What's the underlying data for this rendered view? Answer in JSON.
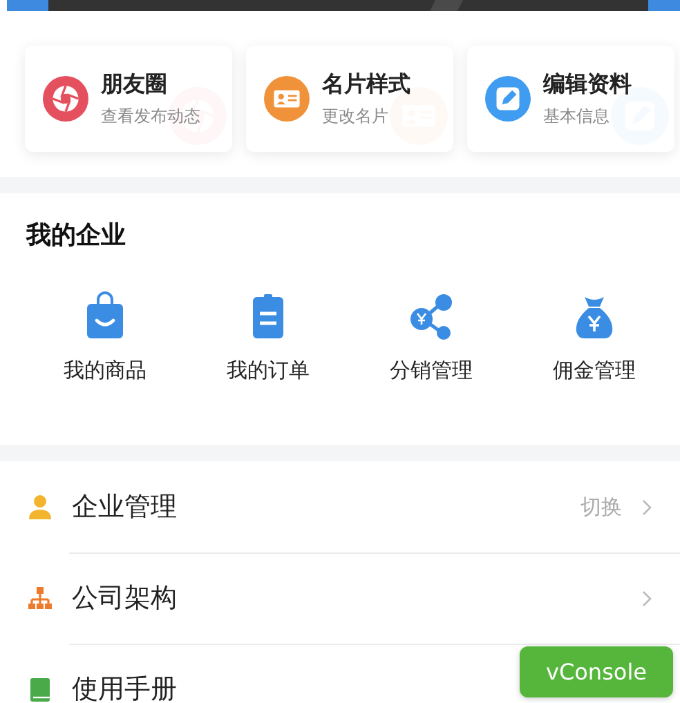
{
  "shortcuts": [
    {
      "kind": "aperture",
      "title": "朋友圈",
      "subtitle": "查看发布动态"
    },
    {
      "kind": "card",
      "title": "名片样式",
      "subtitle": "更改名片"
    },
    {
      "kind": "pencil",
      "title": "编辑资料",
      "subtitle": "基本信息"
    }
  ],
  "enterprise": {
    "title": "我的企业",
    "items": [
      {
        "kind": "bag",
        "label": "我的商品"
      },
      {
        "kind": "clipboard",
        "label": "我的订单"
      },
      {
        "kind": "share",
        "label": "分销管理"
      },
      {
        "kind": "moneybag",
        "label": "佣金管理"
      }
    ]
  },
  "menu": [
    {
      "kind": "person",
      "label": "企业管理",
      "value": "切换",
      "chevron": true
    },
    {
      "kind": "org",
      "label": "公司架构",
      "chevron": true
    },
    {
      "kind": "book",
      "label": "使用手册",
      "chevron": false
    }
  ],
  "vconsole": {
    "label": "vConsole"
  }
}
